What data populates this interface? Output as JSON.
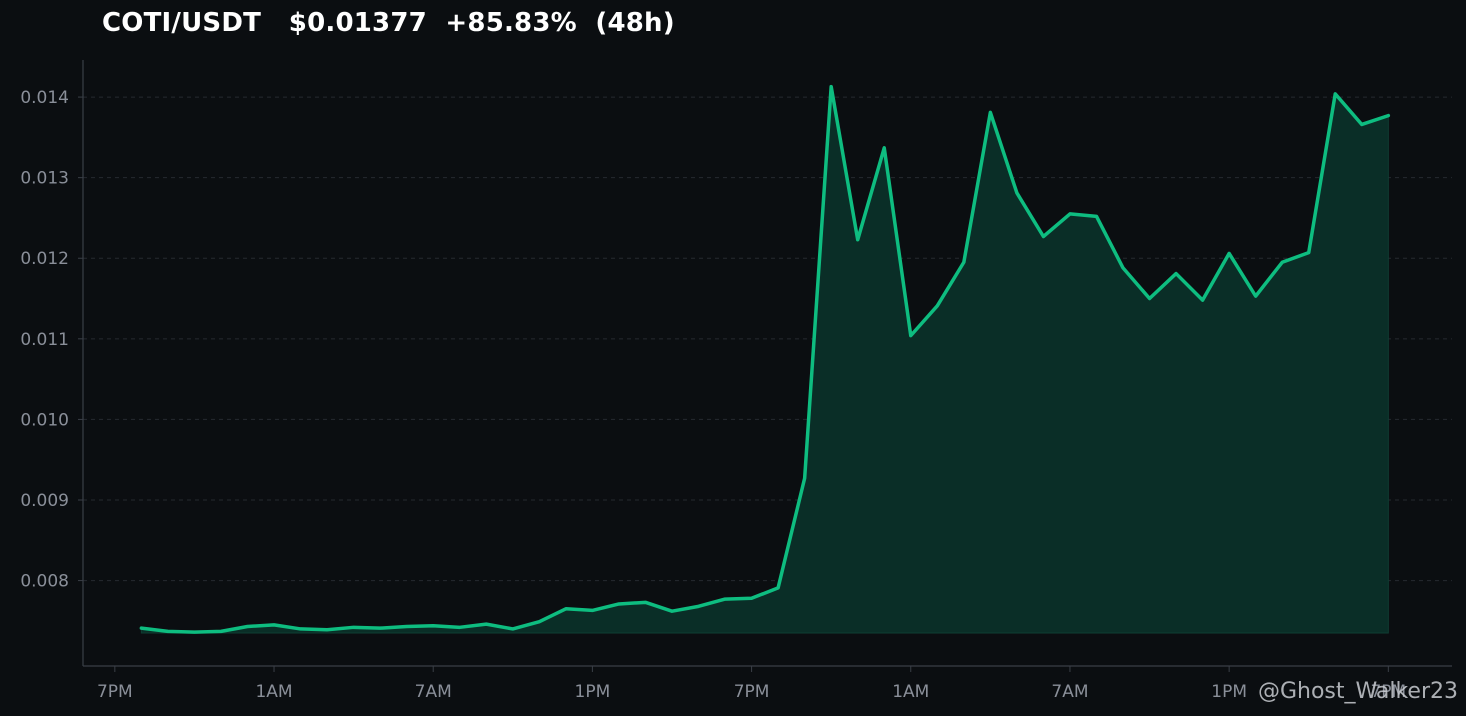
{
  "title": "COTI/USDT   $0.01377  +85.83%  (48h)",
  "watermark": "@Ghost_Walker23",
  "colors": {
    "background": "#0b0e11",
    "line": "#0ebd80",
    "fill": "#0a2e27",
    "grid": "#262a30",
    "axis": "#3a3f47",
    "tick_text": "#8a8f99",
    "title": "#ffffff"
  },
  "chart_data": {
    "type": "area",
    "title": "COTI/USDT   $0.01377  +85.83%  (48h)",
    "xlabel": "",
    "ylabel": "",
    "grid": "horizontal dashed",
    "x_tick_labels": [
      "7PM",
      "1AM",
      "7AM",
      "1PM",
      "7PM",
      "1AM",
      "7AM",
      "1PM",
      "7PM"
    ],
    "x_tick_hours": [
      0,
      6,
      12,
      18,
      24,
      30,
      36,
      42,
      48
    ],
    "xlim_hours": [
      -1.2,
      50.4
    ],
    "y_ticks": [
      0.008,
      0.009,
      0.01,
      0.011,
      0.012,
      0.013,
      0.014
    ],
    "y_tick_labels": [
      "0.008",
      "0.009",
      "0.010",
      "0.011",
      "0.012",
      "0.013",
      "0.014"
    ],
    "ylim": [
      0.00694,
      0.01446
    ],
    "fill_baseline": 0.00735,
    "series": [
      {
        "x_hours": [
          1,
          2,
          3,
          4,
          5,
          6,
          7,
          8,
          9,
          10,
          11,
          12,
          13,
          14,
          15,
          16,
          17,
          18,
          19,
          20,
          21,
          22,
          23,
          24,
          25,
          26,
          27,
          28,
          29,
          30,
          31,
          32,
          33,
          34,
          35,
          36,
          37,
          38,
          39,
          40,
          41,
          42,
          43,
          44,
          45,
          46,
          47,
          48
        ],
        "values": [
          0.00741,
          0.00737,
          0.00736,
          0.00737,
          0.00743,
          0.00745,
          0.0074,
          0.00739,
          0.00742,
          0.00741,
          0.00743,
          0.00744,
          0.00742,
          0.00746,
          0.0074,
          0.00749,
          0.00765,
          0.00763,
          0.00771,
          0.00773,
          0.00762,
          0.00768,
          0.00777,
          0.00778,
          0.00791,
          0.00927,
          0.01413,
          0.01223,
          0.01337,
          0.01104,
          0.01141,
          0.01195,
          0.01381,
          0.01281,
          0.01227,
          0.01255,
          0.01252,
          0.01188,
          0.0115,
          0.01181,
          0.01148,
          0.01206,
          0.01153,
          0.01195,
          0.01207,
          0.01404,
          0.01366,
          0.01377
        ]
      }
    ]
  }
}
